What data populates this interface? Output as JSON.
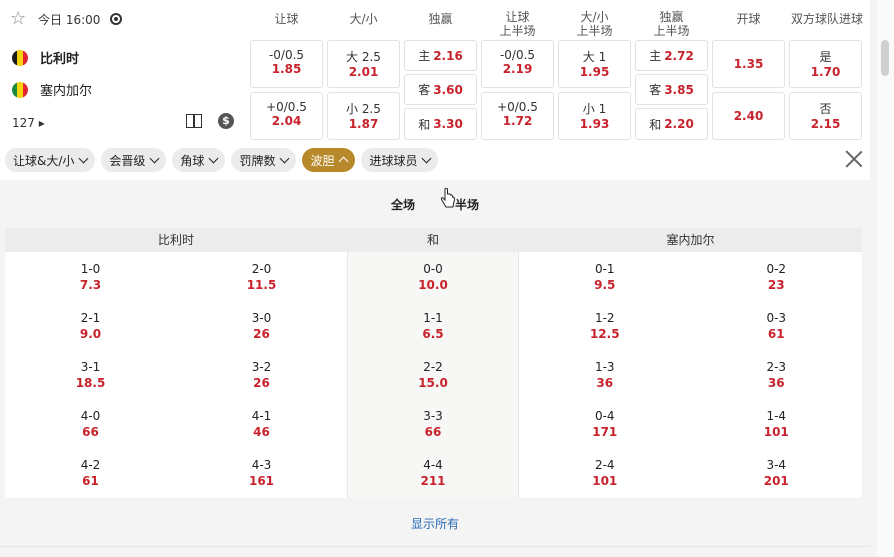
{
  "match": {
    "time": "今日 16:00",
    "more_count": "127"
  },
  "teams": [
    {
      "name": "比利时",
      "flag": [
        "#1a1a1a",
        "#f5d20f",
        "#e3262e"
      ]
    },
    {
      "name": "塞内加尔",
      "flag": [
        "#1b8a3a",
        "#f5d20f",
        "#e3262e"
      ]
    }
  ],
  "columns": [
    {
      "label": "让球"
    },
    {
      "label": "大/小"
    },
    {
      "label": "独赢"
    },
    {
      "label1": "让球",
      "label2": "上半场"
    },
    {
      "label1": "大/小",
      "label2": "上半场"
    },
    {
      "label1": "独赢",
      "label2": "上半场"
    },
    {
      "label": "开球"
    },
    {
      "label": "双方球队进球"
    }
  ],
  "odds": {
    "hdp": [
      {
        "lbl": "-0/0.5",
        "odd": "1.85"
      },
      {
        "lbl": "+0/0.5",
        "odd": "2.04"
      }
    ],
    "ou": [
      {
        "lbl": "大 2.5",
        "odd": "2.01"
      },
      {
        "lbl": "小 2.5",
        "odd": "1.87"
      }
    ],
    "x12": [
      {
        "lbl": "主",
        "odd": "2.16"
      },
      {
        "lbl": "客",
        "odd": "3.60"
      },
      {
        "lbl": "和",
        "odd": "3.30"
      }
    ],
    "hdp_h1": [
      {
        "lbl": "-0/0.5",
        "odd": "2.19"
      },
      {
        "lbl": "+0/0.5",
        "odd": "1.72"
      }
    ],
    "ou_h1": [
      {
        "lbl": "大 1",
        "odd": "1.95"
      },
      {
        "lbl": "小 1",
        "odd": "1.93"
      }
    ],
    "x12_h1": [
      {
        "lbl": "主",
        "odd": "2.72"
      },
      {
        "lbl": "客",
        "odd": "3.85"
      },
      {
        "lbl": "和",
        "odd": "2.20"
      }
    ],
    "kickoff": [
      {
        "odd": "1.35"
      },
      {
        "odd": "2.40"
      }
    ],
    "btts": [
      {
        "lbl": "是",
        "odd": "1.70"
      },
      {
        "lbl": "否",
        "odd": "2.15"
      }
    ]
  },
  "filters": [
    {
      "label": "让球&大/小",
      "active": false
    },
    {
      "label": "会晋级",
      "active": false
    },
    {
      "label": "角球",
      "active": false
    },
    {
      "label": "罚牌数",
      "active": false
    },
    {
      "label": "波胆",
      "active": true
    },
    {
      "label": "进球球员",
      "active": false
    }
  ],
  "period_tabs": [
    "全场",
    "半场"
  ],
  "correct_score": {
    "headers": [
      "比利时",
      "和",
      "塞内加尔"
    ],
    "home_a": [
      {
        "s": "1-0",
        "o": "7.3"
      },
      {
        "s": "2-1",
        "o": "9.0"
      },
      {
        "s": "3-1",
        "o": "18.5"
      },
      {
        "s": "4-0",
        "o": "66"
      },
      {
        "s": "4-2",
        "o": "61"
      }
    ],
    "home_b": [
      {
        "s": "2-0",
        "o": "11.5"
      },
      {
        "s": "3-0",
        "o": "26"
      },
      {
        "s": "3-2",
        "o": "26"
      },
      {
        "s": "4-1",
        "o": "46"
      },
      {
        "s": "4-3",
        "o": "161"
      }
    ],
    "draw": [
      {
        "s": "0-0",
        "o": "10.0"
      },
      {
        "s": "1-1",
        "o": "6.5"
      },
      {
        "s": "2-2",
        "o": "15.0"
      },
      {
        "s": "3-3",
        "o": "66"
      },
      {
        "s": "4-4",
        "o": "211"
      }
    ],
    "away_a": [
      {
        "s": "0-1",
        "o": "9.5"
      },
      {
        "s": "1-2",
        "o": "12.5"
      },
      {
        "s": "1-3",
        "o": "36"
      },
      {
        "s": "0-4",
        "o": "171"
      },
      {
        "s": "2-4",
        "o": "101"
      }
    ],
    "away_b": [
      {
        "s": "0-2",
        "o": "23"
      },
      {
        "s": "0-3",
        "o": "61"
      },
      {
        "s": "2-3",
        "o": "36"
      },
      {
        "s": "1-4",
        "o": "101"
      },
      {
        "s": "3-4",
        "o": "201"
      }
    ]
  },
  "show_all": "显示所有"
}
